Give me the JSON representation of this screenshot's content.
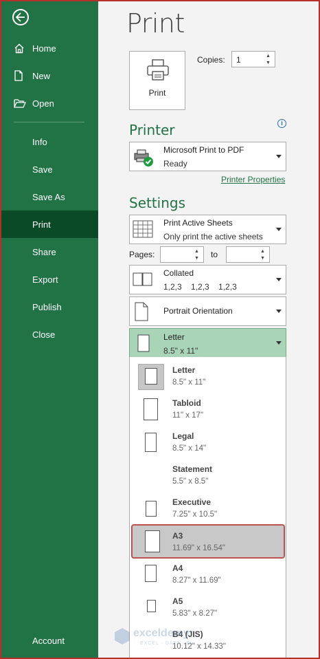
{
  "sidebar": {
    "items": [
      {
        "label": "Home",
        "icon": "home-icon"
      },
      {
        "label": "New",
        "icon": "new-document-icon"
      },
      {
        "label": "Open",
        "icon": "open-folder-icon"
      },
      {
        "label": "Info"
      },
      {
        "label": "Save"
      },
      {
        "label": "Save As"
      },
      {
        "label": "Print",
        "active": true
      },
      {
        "label": "Share"
      },
      {
        "label": "Export"
      },
      {
        "label": "Publish"
      },
      {
        "label": "Close"
      }
    ],
    "account": "Account",
    "bg_color": "#217346",
    "active_color": "#0a4a26"
  },
  "page": {
    "title": "Print",
    "print_button": "Print",
    "copies_label": "Copies:",
    "copies_value": "1"
  },
  "printer": {
    "heading": "Printer",
    "name": "Microsoft Print to PDF",
    "status": "Ready",
    "properties_link": "Printer Properties"
  },
  "settings": {
    "heading": "Settings",
    "scope": {
      "title": "Print Active Sheets",
      "sub": "Only print the active sheets"
    },
    "pages_label": "Pages:",
    "to_label": "to",
    "pages_from": "",
    "pages_to": "",
    "collation": {
      "title": "Collated",
      "sub": "1,2,3    1,2,3    1,2,3"
    },
    "orientation": {
      "title": "Portrait Orientation"
    },
    "paper": {
      "title": "Letter",
      "sub": "8.5\" x 11\"",
      "highlight_color": "#a9d4b8"
    }
  },
  "paper_options": [
    {
      "name": "Letter",
      "size": "8.5\" x 11\""
    },
    {
      "name": "Tabloid",
      "size": "11\" x 17\""
    },
    {
      "name": "Legal",
      "size": "8.5\" x 14\""
    },
    {
      "name": "Statement",
      "size": "5.5\" x 8.5\""
    },
    {
      "name": "Executive",
      "size": "7.25\" x 10.5\""
    },
    {
      "name": "A3",
      "size": "11.69\" x 16.54\""
    },
    {
      "name": "A4",
      "size": "8.27\" x 11.69\""
    },
    {
      "name": "A5",
      "size": "5.83\" x 8.27\""
    },
    {
      "name": "B4 (JIS)",
      "size": "10.12\" x 14.33\""
    }
  ],
  "watermark": {
    "name": "exceldemy",
    "tagline": "EXCEL · DATA · BI"
  }
}
